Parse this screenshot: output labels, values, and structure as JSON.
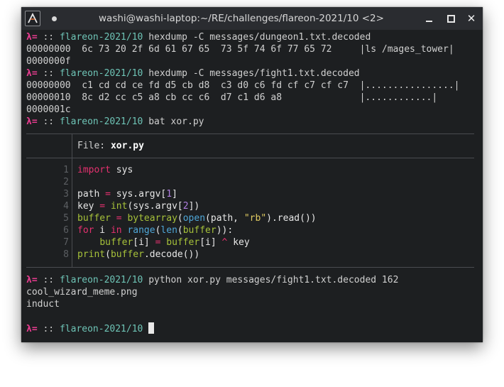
{
  "window": {
    "title": "washi@washi-laptop:~/RE/challenges/flareon-2021/10 <2>",
    "close_glyph": "✕"
  },
  "prompt": {
    "symbol": "λ=",
    "separator": "::",
    "cwd": "flareon-2021/10"
  },
  "commands": [
    "hexdump -C messages/dungeon1.txt.decoded",
    "hexdump -C messages/fight1.txt.decoded",
    "bat xor.py",
    "python xor.py messages/fight1.txt.decoded 162"
  ],
  "hexdump1": [
    "00000000  6c 73 20 2f 6d 61 67 65  73 5f 74 6f 77 65 72     |ls /mages_tower|",
    "0000000f"
  ],
  "hexdump2": [
    "00000000  c1 cd cd ce fd d5 cb d8  c3 d0 c6 fd cf c7 cf c7  |................|",
    "00000010  8c d2 cc c5 a8 cb cc c6  d7 c1 d6 a8              |............|",
    "0000001c"
  ],
  "bat": {
    "file_label": "File:",
    "file_name": "xor.py",
    "line_numbers": [
      "1",
      "2",
      "3",
      "4",
      "5",
      "6",
      "7",
      "8"
    ],
    "code": {
      "l1_kw": "import",
      "l1_mod": " sys",
      "l3_var": "path",
      "l3_op": " = ",
      "l3_a": "sys.argv[",
      "l3_num": "1",
      "l3_b": "]",
      "l4_var": "key",
      "l4_op": " = ",
      "l4_fn": "int",
      "l4_a": "(sys.argv[",
      "l4_num": "2",
      "l4_b": "])",
      "l5_var": "buffer",
      "l5_op": " = ",
      "l5_fn": "bytearray",
      "l5_a": "(",
      "l5_fn2": "open",
      "l5_b": "(path, ",
      "l5_str": "\"rb\"",
      "l5_c": ").read())",
      "l6_kw": "for",
      "l6_a": " i ",
      "l6_kw2": "in",
      "l6_b": " ",
      "l6_fn": "range",
      "l6_c": "(",
      "l6_fn2": "len",
      "l6_d": "(",
      "l6_var": "buffer",
      "l6_e": ")):",
      "l7_indent": "    ",
      "l7_var": "buffer",
      "l7_a": "[i]",
      "l7_op": " = ",
      "l7_var2": "buffer",
      "l7_b": "[i]",
      "l7_op2": " ^ ",
      "l7_c": "key",
      "l8_fn": "print",
      "l8_a": "(",
      "l8_var": "buffer",
      "l8_b": ".decode())"
    }
  },
  "python_output": [
    "cool_wizard_meme.png",
    "induct"
  ]
}
